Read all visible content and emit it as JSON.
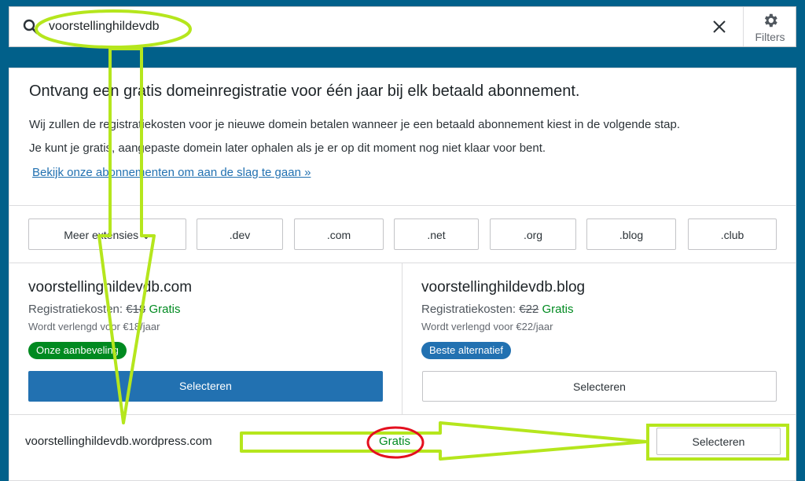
{
  "search": {
    "value": "voorstellinghildevdb",
    "filters_label": "Filters"
  },
  "promo": {
    "title": "Ontvang een gratis domeinregistratie voor één jaar bij elk betaald abonnement.",
    "line1": "Wij zullen de registratiekosten voor je nieuwe domein betalen wanneer je een betaald abonnement kiest in de volgende stap.",
    "line2": "Je kunt je gratis, aangepaste domein later ophalen als je er op dit moment nog niet klaar voor bent.",
    "link": "Bekijk onze abonnementen om aan de slag te gaan »"
  },
  "extensions": [
    "Meer extensies ⌄",
    ".dev",
    ".com",
    ".net",
    ".org",
    ".blog",
    ".club"
  ],
  "cards": [
    {
      "domain": "voorstellinghildevdb.com",
      "cost_label": "Registratiekosten:",
      "old_price": "€18",
      "free": "Gratis",
      "renew": "Wordt verlengd voor €18/jaar",
      "badge": "Onze aanbeveling",
      "select": "Selecteren"
    },
    {
      "domain": "voorstellinghildevdb.blog",
      "cost_label": "Registratiekosten:",
      "old_price": "€22",
      "free": "Gratis",
      "renew": "Wordt verlengd voor €22/jaar",
      "badge": "Beste alternatief",
      "select": "Selecteren"
    }
  ],
  "wordpress": {
    "domain": "voorstellinghildevdb.wordpress.com",
    "free": "Gratis",
    "select": "Selecteren"
  },
  "colors": {
    "background": "#01608a",
    "primary": "#2271b1",
    "success": "#008a20",
    "annotation_green": "#b5e61d",
    "annotation_red": "#e4101f"
  },
  "icons": [
    "search-icon",
    "close-icon",
    "gear-icon"
  ]
}
